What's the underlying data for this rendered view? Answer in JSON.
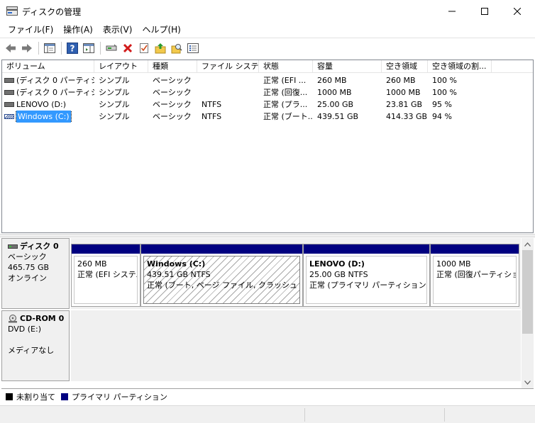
{
  "window": {
    "title": "ディスクの管理"
  },
  "menu": [
    {
      "label": "ファイル(F)"
    },
    {
      "label": "操作(A)"
    },
    {
      "label": "表示(V)"
    },
    {
      "label": "ヘルプ(H)"
    }
  ],
  "columns": [
    "ボリューム",
    "レイアウト",
    "種類",
    "ファイル システム",
    "状態",
    "容量",
    "空き領域",
    "空き領域の割..."
  ],
  "volumes": [
    {
      "name": "(ディスク 0 パーティシ...",
      "layout": "シンプル",
      "type": "ベーシック",
      "fs": "",
      "status": "正常 (EFI ...",
      "capacity": "260 MB",
      "free": "260 MB",
      "pct": "100 %"
    },
    {
      "name": "(ディスク 0 パーティシ...",
      "layout": "シンプル",
      "type": "ベーシック",
      "fs": "",
      "status": "正常 (回復...",
      "capacity": "1000 MB",
      "free": "1000 MB",
      "pct": "100 %"
    },
    {
      "name": "LENOVO (D:)",
      "layout": "シンプル",
      "type": "ベーシック",
      "fs": "NTFS",
      "status": "正常 (プラ...",
      "capacity": "25.00 GB",
      "free": "23.81 GB",
      "pct": "95 %"
    },
    {
      "name": "Windows (C:)",
      "layout": "シンプル",
      "type": "ベーシック",
      "fs": "NTFS",
      "status": "正常 (ブート...",
      "capacity": "439.51 GB",
      "free": "414.33 GB",
      "pct": "94 %"
    }
  ],
  "disk0": {
    "name": "ディスク 0",
    "type": "ベーシック",
    "size": "465.75 GB",
    "state": "オンライン",
    "partitions": [
      {
        "title": "",
        "size": "260 MB",
        "status": "正常 (EFI システム パーティション)"
      },
      {
        "title": "Windows  (C:)",
        "size": "439.51 GB NTFS",
        "status": "正常 (ブート, ページ ファイル, クラッシュ ダンプ, プライマリ パーティション)"
      },
      {
        "title": "LENOVO  (D:)",
        "size": "25.00 GB NTFS",
        "status": "正常 (プライマリ パーティション)"
      },
      {
        "title": "",
        "size": "1000 MB",
        "status": "正常 (回復パーティション)"
      }
    ]
  },
  "cdrom": {
    "name": "CD-ROM 0",
    "drive": "DVD (E:)",
    "state": "メディアなし"
  },
  "legend": [
    {
      "label": "未割り当て",
      "color": "#000000"
    },
    {
      "label": "プライマリ パーティション",
      "color": "#000080"
    }
  ]
}
